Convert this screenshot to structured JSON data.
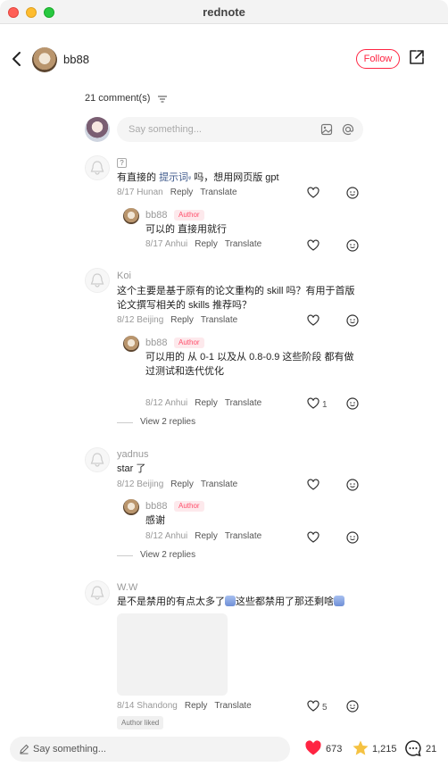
{
  "window": {
    "title": "rednote"
  },
  "header": {
    "username": "bb88",
    "follow_label": "Follow"
  },
  "comments_header": {
    "count_label": "21 comment(s)"
  },
  "input_top": {
    "placeholder": "Say something..."
  },
  "comments": [
    {
      "flag": "?",
      "text_before": "有直接的 ",
      "link": "提示词",
      "text_after": " 吗，想用网页版 gpt",
      "meta": "8/17 Hunan",
      "reply": {
        "name": "bb88",
        "badge": "Author",
        "text": "可以的 直接用就行",
        "meta": "8/17 Anhui"
      }
    },
    {
      "name": "Koi",
      "text_line1": "这个主要是基于原有的论文重构的 skill 吗？有用于首版",
      "text_line2": "论文撰写相关的 skills 推荐吗？",
      "meta": "8/12 Beijing",
      "reply": {
        "name": "bb88",
        "badge": "Author",
        "text_line1": "可以用的 从 0-1 以及从 0.8-0.9 这些阶段 都有做",
        "text_line2": "过测试和迭代优化",
        "meta": "8/12 Anhui",
        "likes": "1"
      },
      "view_more": "View 2 replies"
    },
    {
      "name": "yadnus",
      "text": "star 了",
      "meta": "8/12 Beijing",
      "reply": {
        "name": "bb88",
        "badge": "Author",
        "text": "感谢",
        "meta": "8/12 Anhui"
      },
      "view_more": "View 2 replies"
    },
    {
      "name": "W.W",
      "text_before": "是不是禁用的有点太多了",
      "text_middle": "这些都禁用了那还剩啥",
      "meta": "8/14 Shandong",
      "likes": "5",
      "author_liked": "Author liked"
    }
  ],
  "actions": {
    "reply": "Reply",
    "translate": "Translate"
  },
  "bottom": {
    "placeholder": "Say something...",
    "likes": "673",
    "stars": "1,215",
    "comments": "21"
  },
  "colors": {
    "accent": "#ff2442",
    "like_red": "#ff2442",
    "star_yellow": "#f5c242"
  }
}
